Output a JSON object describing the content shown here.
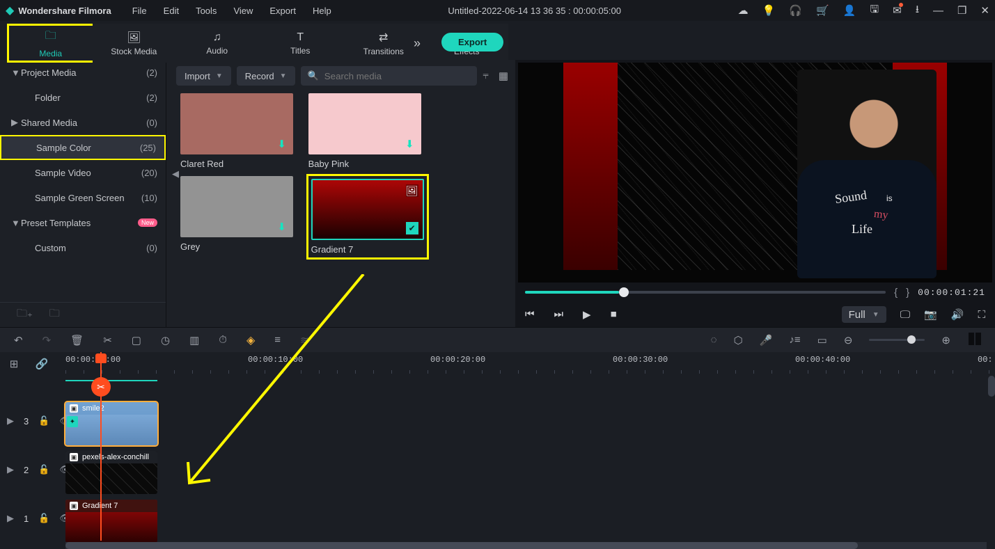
{
  "titlebar": {
    "app_name": "Wondershare Filmora",
    "menus": [
      "File",
      "Edit",
      "Tools",
      "View",
      "Export",
      "Help"
    ],
    "project_title": "Untitled-2022-06-14 13 36 35 : 00:00:05:00"
  },
  "tabs": [
    {
      "label": "Media",
      "icon": "folder-icon"
    },
    {
      "label": "Stock Media",
      "icon": "image-icon"
    },
    {
      "label": "Audio",
      "icon": "music-icon"
    },
    {
      "label": "Titles",
      "icon": "text-icon"
    },
    {
      "label": "Transitions",
      "icon": "transition-icon"
    },
    {
      "label": "Effects",
      "icon": "sparkle-icon"
    }
  ],
  "export_label": "Export",
  "tree": {
    "items": [
      {
        "label": "Project Media",
        "count": "(2)",
        "caret": "▼",
        "indent": false
      },
      {
        "label": "Folder",
        "count": "(2)",
        "caret": "",
        "indent": true
      },
      {
        "label": "Shared Media",
        "count": "(0)",
        "caret": "▶",
        "indent": false
      },
      {
        "label": "Sample Color",
        "count": "(25)",
        "caret": "",
        "indent": true,
        "selected": true
      },
      {
        "label": "Sample Video",
        "count": "(20)",
        "caret": "",
        "indent": true
      },
      {
        "label": "Sample Green Screen",
        "count": "(10)",
        "caret": "",
        "indent": true
      },
      {
        "label": "Preset Templates",
        "count": "",
        "caret": "▼",
        "indent": false,
        "new": true
      },
      {
        "label": "Custom",
        "count": "(0)",
        "caret": "",
        "indent": true
      }
    ],
    "new_tag": "New"
  },
  "mid": {
    "import_label": "Import",
    "record_label": "Record",
    "search_placeholder": "Search media",
    "thumbs": [
      {
        "label": "Claret Red",
        "bg": "#a86a62"
      },
      {
        "label": "Baby Pink",
        "bg": "#f6c9cd"
      },
      {
        "label": "Grey",
        "bg": "#939393"
      },
      {
        "label": "Gradient 7",
        "bg": "linear-gradient(180deg,#b00606,#170101)",
        "selected": true
      }
    ]
  },
  "preview": {
    "shirt_text1": "Sound",
    "shirt_text2": "Life",
    "shirt_text3": "my",
    "shirt_is": "is",
    "timecode": "00:00:01:21",
    "quality_label": "Full"
  },
  "timeline": {
    "ruler": [
      "00:00:00:00",
      "00:00:10:00",
      "00:00:20:00",
      "00:00:30:00",
      "00:00:40:00"
    ],
    "ruler_tail": "00:",
    "tracks": [
      {
        "num": "3",
        "clip_label": "smile2",
        "icon": "▣"
      },
      {
        "num": "2",
        "clip_label": "pexels-alex-conchill",
        "icon": "▣"
      },
      {
        "num": "1",
        "clip_label": "Gradient 7",
        "icon": "▣"
      }
    ]
  }
}
